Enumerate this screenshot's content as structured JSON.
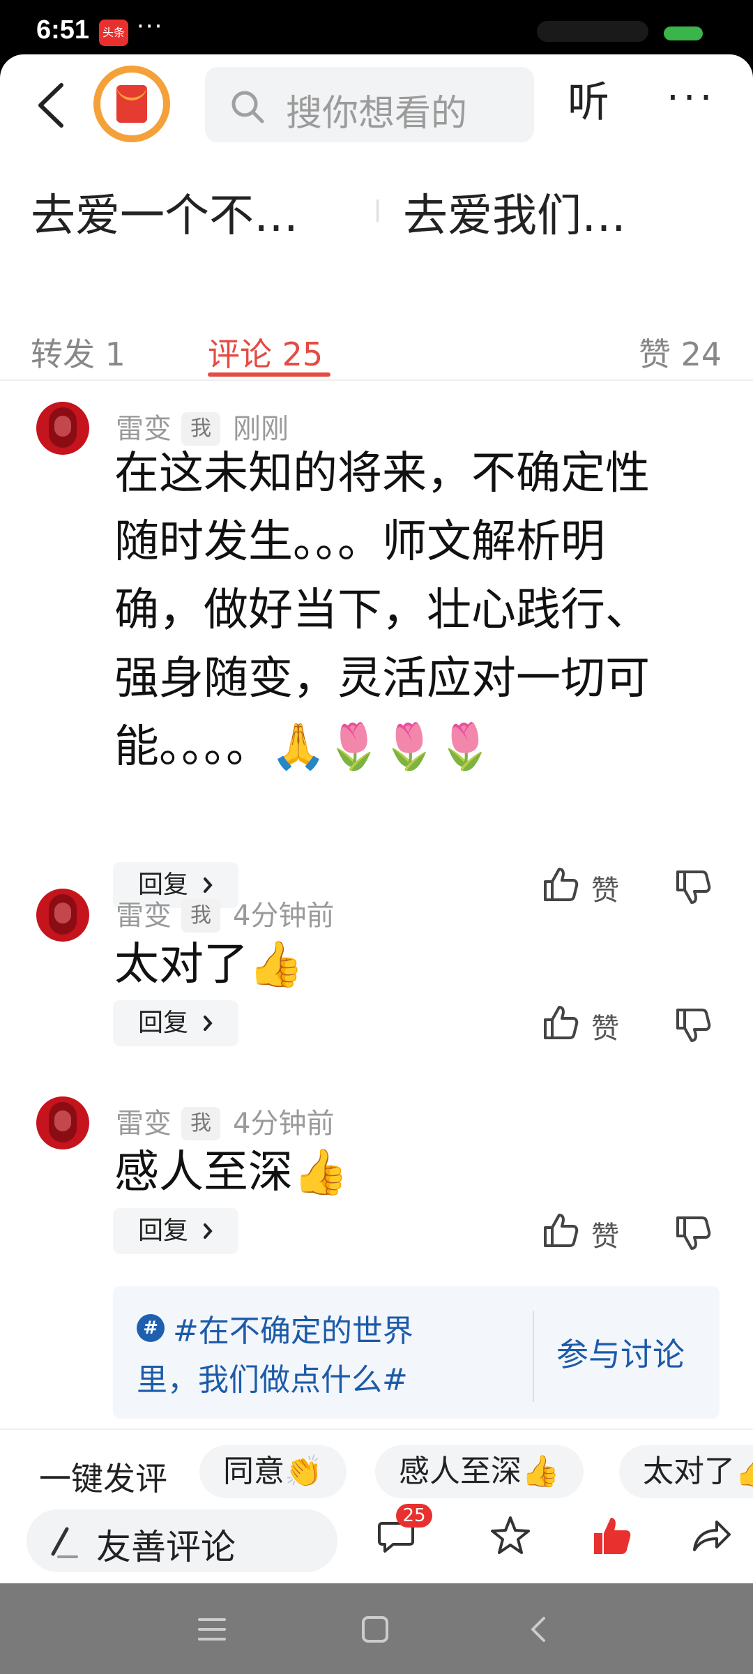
{
  "status_bar": {
    "time": "6:51",
    "app_badge": "头条",
    "more": "···"
  },
  "header": {
    "search_placeholder": "搜你想看的",
    "listen_label": "听",
    "more_label": "···"
  },
  "related_titles": [
    "去爱一个不…",
    "去爱我们…"
  ],
  "tabs": [
    {
      "label": "转发 1"
    },
    {
      "label": "评论 25"
    },
    {
      "label": "赞 24"
    }
  ],
  "comments": [
    {
      "user": "雷变",
      "tag": "我",
      "time": "刚刚",
      "lines": [
        "在这未知的将来，不确定性",
        "随时发生。。。师文解析明",
        "确，做好当下，壮心践行、",
        "强身随变，灵活应对一切可",
        "能。。。。🙏🌷🌷🌷"
      ],
      "reply_label": "回复",
      "like_label": "赞"
    },
    {
      "user": "雷变",
      "tag": "我",
      "time": "4分钟前",
      "lines": [
        "太对了👍"
      ],
      "reply_label": "回复",
      "like_label": "赞"
    },
    {
      "user": "雷变",
      "tag": "我",
      "time": "4分钟前",
      "lines": [
        "感人至深👍"
      ],
      "reply_label": "回复",
      "like_label": "赞"
    }
  ],
  "topic": {
    "badge": "#",
    "text": "#在不确定的世界里，我们做点什么#",
    "action": "参与讨论"
  },
  "quick_comment": {
    "lead": "一键发评",
    "chips": [
      "同意👏",
      "感人至深👍",
      "太对了👍"
    ]
  },
  "input_bar": {
    "placeholder": "友善评论"
  },
  "actions": {
    "comment_count": "25"
  },
  "colors": {
    "accent": "#e44b43",
    "link": "#1c5ba8",
    "badge": "#e8302f"
  }
}
